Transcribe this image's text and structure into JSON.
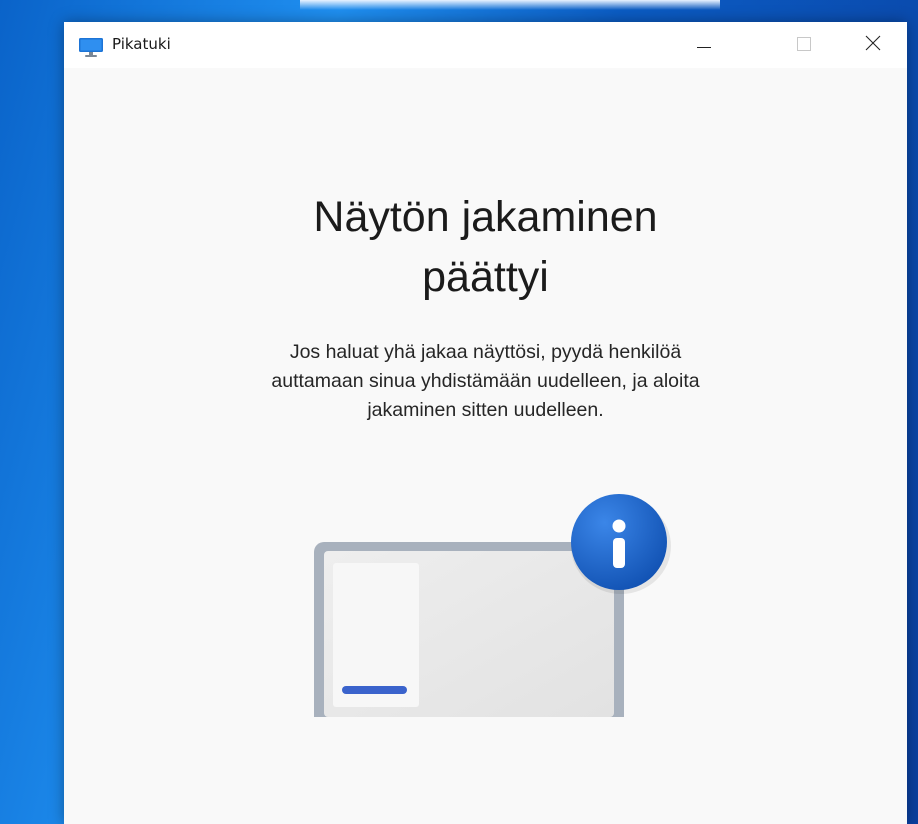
{
  "window": {
    "title": "Pikatuki",
    "app_icon": "monitor-icon",
    "controls": {
      "minimize": "minimize-icon",
      "maximize": "maximize-icon",
      "close": "close-icon"
    }
  },
  "main": {
    "heading_line1": "Näytön jakaminen",
    "heading_line2": "päättyi",
    "body_line1": "Jos haluat yhä jakaa näyttösi, pyydä henkilöä",
    "body_line2": "auttamaan sinua yhdistämään uudelleen, ja aloita",
    "body_line3": "jakaminen sitten uudelleen.",
    "illustration": {
      "laptop_icon": "laptop-icon",
      "info_icon": "info-icon"
    }
  },
  "colors": {
    "desktop_accent": "#0a63c9",
    "window_background": "#f9f9f9",
    "info_badge": "#1b5fc1",
    "progress_bar": "#3a63cc",
    "laptop_frame": "#a8b1bd"
  }
}
